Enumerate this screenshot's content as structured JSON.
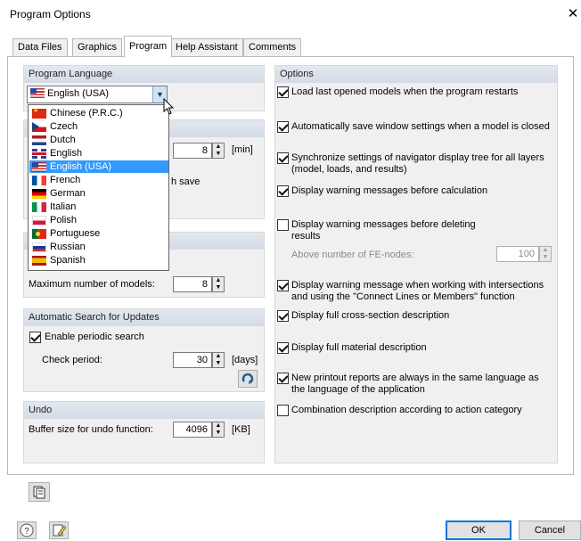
{
  "window": {
    "title": "Program Options",
    "close_glyph": "✕"
  },
  "tabs": [
    {
      "label": "Data Files",
      "active": false
    },
    {
      "label": "Graphics",
      "active": false
    },
    {
      "label": "Program",
      "active": true
    },
    {
      "label": "Help Assistant",
      "active": false
    },
    {
      "label": "Comments",
      "active": false
    }
  ],
  "program_language": {
    "title": "Program Language",
    "selected": "English (USA)",
    "options": [
      {
        "label": "Chinese (P.R.C.)",
        "flag": "cn"
      },
      {
        "label": "Czech",
        "flag": "cz"
      },
      {
        "label": "Dutch",
        "flag": "nl"
      },
      {
        "label": "English",
        "flag": "gb"
      },
      {
        "label": "English (USA)",
        "flag": "us",
        "selected": true
      },
      {
        "label": "French",
        "flag": "fr"
      },
      {
        "label": "German",
        "flag": "de"
      },
      {
        "label": "Italian",
        "flag": "it"
      },
      {
        "label": "Polish",
        "flag": "pl"
      },
      {
        "label": "Portuguese",
        "flag": "pt"
      },
      {
        "label": "Russian",
        "flag": "ru"
      },
      {
        "label": "Spanish",
        "flag": "es"
      }
    ]
  },
  "autosave": {
    "interval_value": "8",
    "interval_unit": "[min]",
    "partial_label": "h save"
  },
  "models": {
    "max_models_label": "Maximum number of models:",
    "max_models_value": "8"
  },
  "updates": {
    "title": "Automatic Search for Updates",
    "enable_label": "Enable periodic search",
    "enable_checked": true,
    "period_label": "Check period:",
    "period_value": "30",
    "period_unit": "[days]"
  },
  "undo": {
    "title": "Undo",
    "buffer_label": "Buffer size for undo function:",
    "buffer_value": "4096",
    "buffer_unit": "[KB]"
  },
  "options": {
    "title": "Options",
    "items": [
      {
        "label": "Load last opened models when the program restarts",
        "checked": true
      },
      {
        "label": "Automatically save window settings when a model is closed",
        "checked": true
      },
      {
        "label": "Synchronize settings of navigator display tree for all layers (model, loads, and results)",
        "checked": true
      },
      {
        "label": "Display warning messages before calculation",
        "checked": true
      },
      {
        "label": "Display warning messages before deleting results",
        "checked": false
      },
      {
        "label": "Display warning message when working with intersections and using the \"Connect Lines or Members\" function",
        "checked": true
      },
      {
        "label": "Display full cross-section description",
        "checked": true
      },
      {
        "label": "Display full material description",
        "checked": true
      },
      {
        "label": "New printout reports are always in the same language as the language of the application",
        "checked": true
      },
      {
        "label": "Combination description according to action category",
        "checked": false
      }
    ],
    "fe_nodes_label": "Above number of FE-nodes:",
    "fe_nodes_value": "100"
  },
  "footer": {
    "ok_label": "OK",
    "cancel_label": "Cancel"
  },
  "icons": {
    "help": "help-icon",
    "edit": "edit-icon",
    "defaults": "defaults-icon",
    "check_now": "check-now-icon"
  }
}
